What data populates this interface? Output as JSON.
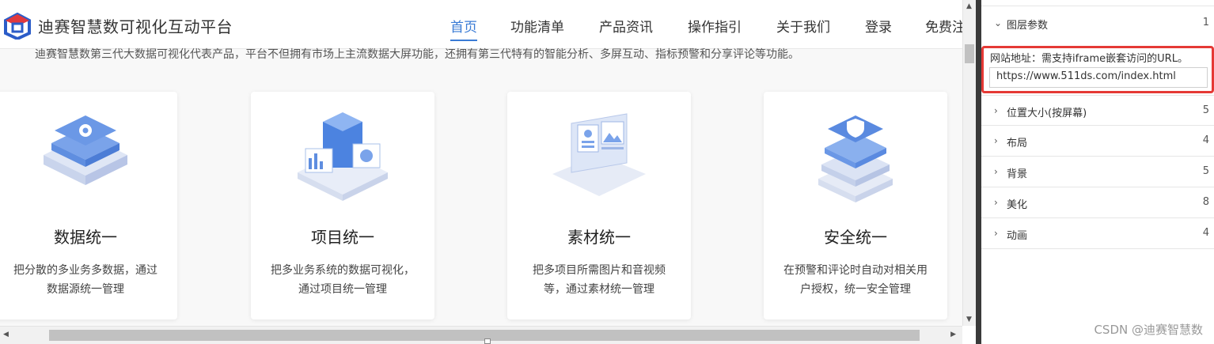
{
  "site": {
    "logo_text": "迪赛智慧数可视化互动平台",
    "nav": [
      {
        "label": "首页",
        "active": true
      },
      {
        "label": "功能清单",
        "active": false
      },
      {
        "label": "产品资讯",
        "active": false
      },
      {
        "label": "操作指引",
        "active": false
      },
      {
        "label": "关于我们",
        "active": false
      },
      {
        "label": "登录",
        "active": false
      },
      {
        "label": "免费注",
        "active": false
      }
    ],
    "intro": "迪赛智慧数第三代大数据可视化代表产品，平台不但拥有市场上主流数据大屏功能，还拥有第三代特有的智能分析、多屏互动、指标预警和分享评论等功能。",
    "cards": [
      {
        "title": "数据统一",
        "desc_line1": "把分散的多业务多数据，通过",
        "desc_line2": "数据源统一管理",
        "icon": "database-gear-icon"
      },
      {
        "title": "项目统一",
        "desc_line1": "把多业务系统的数据可视化，",
        "desc_line2": "通过项目统一管理",
        "icon": "project-cube-icon"
      },
      {
        "title": "素材统一",
        "desc_line1": "把多项目所需图片和音视频",
        "desc_line2": "等，通过素材统一管理",
        "icon": "laptop-media-icon"
      },
      {
        "title": "安全统一",
        "desc_line1": "在预警和评论时自动对相关用",
        "desc_line2": "户授权，统一安全管理",
        "icon": "shield-server-icon"
      }
    ]
  },
  "panel": {
    "sections": [
      {
        "label": "图层参数",
        "count": "1",
        "expanded": true
      },
      {
        "label": "位置大小(按屏幕)",
        "count": "5",
        "expanded": false
      },
      {
        "label": "布局",
        "count": "4",
        "expanded": false
      },
      {
        "label": "背景",
        "count": "5",
        "expanded": false
      },
      {
        "label": "美化",
        "count": "8",
        "expanded": false
      },
      {
        "label": "动画",
        "count": "4",
        "expanded": false
      }
    ],
    "url_field": {
      "label": "网站地址：需支持iframe嵌套访问的URL。",
      "value": "https://www.511ds.com/index.html"
    }
  },
  "watermark": "CSDN @迪赛智慧数",
  "colors": {
    "accent": "#3a7bd5",
    "highlight_border": "#e53935",
    "logo_blue": "#2b5cc8",
    "logo_red": "#e0393e"
  }
}
